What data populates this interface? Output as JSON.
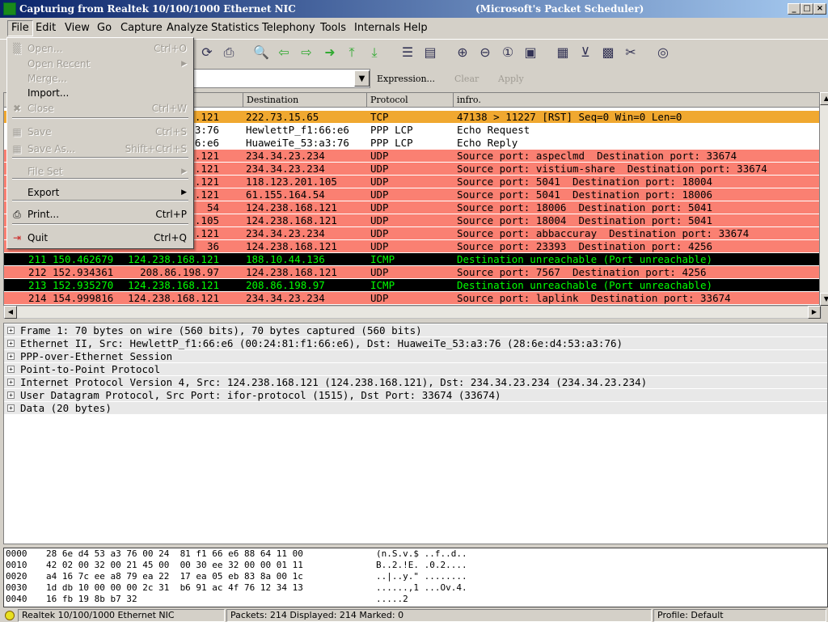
{
  "window": {
    "title": "Capturing from Realtek 10/100/1000 Ethernet NIC",
    "title_suffix": "(Microsoft's Packet Scheduler)",
    "minimize": "_",
    "maximize": "□",
    "close": "×"
  },
  "menubar": [
    "File",
    "Edit",
    "View",
    "Go",
    "Capture",
    "Analyze",
    "Statistics",
    "Telephony",
    "Tools",
    "Internals",
    "Help"
  ],
  "file_menu": [
    {
      "label": "Open...",
      "shortcut": "Ctrl+O",
      "icon": "folder-icon",
      "disabled": true
    },
    {
      "label": "Open Recent",
      "submenu": true,
      "disabled": true
    },
    {
      "label": "Merge...",
      "disabled": true
    },
    {
      "label": "Import...",
      "disabled": false
    },
    {
      "label": "Close",
      "shortcut": "Ctrl+W",
      "icon": "close-icon",
      "disabled": true
    },
    {
      "label": "Save",
      "shortcut": "Ctrl+S",
      "icon": "save-icon",
      "disabled": true
    },
    {
      "label": "Save As...",
      "shortcut": "Shift+Ctrl+S",
      "icon": "save-as-icon",
      "disabled": true
    },
    {
      "label": "File Set",
      "submenu": true,
      "disabled": true
    },
    {
      "label": "Export",
      "submenu": true,
      "disabled": false
    },
    {
      "label": "Print...",
      "shortcut": "Ctrl+P",
      "icon": "printer-icon",
      "disabled": false
    },
    {
      "label": "Quit",
      "shortcut": "Ctrl+Q",
      "icon": "quit-icon",
      "disabled": false
    }
  ],
  "toolbar": {
    "icons": [
      "reload-icon",
      "print-icon",
      "find-icon",
      "go-back-icon",
      "go-forward-icon",
      "go-to-packet-icon",
      "go-first-icon",
      "go-last-icon",
      "colorize-icon",
      "autoscroll-icon",
      "zoom-in-icon",
      "zoom-out-icon",
      "zoom-normal-icon",
      "resize-columns-icon",
      "capture-filters-icon",
      "display-filters-icon",
      "coloring-rules-icon",
      "preferences-icon",
      "help-icon"
    ]
  },
  "filter": {
    "value": "",
    "expression": "Expression...",
    "clear": "Clear",
    "apply": "Apply"
  },
  "packet_list": {
    "columns": [
      "Destination",
      "Protocol",
      "infro."
    ],
    "rows": [
      {
        "no": "",
        "time": "",
        "src": ".121",
        "dst": "222.73.15.65",
        "proto": "TCP",
        "info": "47138 > 11227 [RST] Seq=0 Win=0 Len=0",
        "bg": "#f0a830",
        "fg": "#000000"
      },
      {
        "no": "",
        "time": "",
        "src": ":a3:76",
        "dst": "HewlettP_f1:66:e6",
        "proto": "PPP LCP",
        "info": "Echo Request",
        "bg": "#ffffff",
        "fg": "#000000"
      },
      {
        "no": "",
        "time": "",
        "src": ":66:e6",
        "dst": "HuaweiTe_53:a3:76",
        "proto": "PPP LCP",
        "info": "Echo Reply",
        "bg": "#ffffff",
        "fg": "#000000"
      },
      {
        "no": "",
        "time": "",
        "src": ".121",
        "dst": "234.34.23.234",
        "proto": "UDP",
        "info": "Source port: aspeclmd  Destination port: 33674",
        "bg": "#fa8072",
        "fg": "#000000"
      },
      {
        "no": "",
        "time": "",
        "src": ".121",
        "dst": "234.34.23.234",
        "proto": "UDP",
        "info": "Source port: vistium-share  Destination port: 33674",
        "bg": "#fa8072",
        "fg": "#000000"
      },
      {
        "no": "",
        "time": "",
        "src": ".121",
        "dst": "118.123.201.105",
        "proto": "UDP",
        "info": "Source port: 5041  Destination port: 18004",
        "bg": "#fa8072",
        "fg": "#000000"
      },
      {
        "no": "",
        "time": "",
        "src": ".121",
        "dst": "61.155.164.54",
        "proto": "UDP",
        "info": "Source port: 5041  Destination port: 18006",
        "bg": "#fa8072",
        "fg": "#000000"
      },
      {
        "no": "",
        "time": "",
        "src": "54",
        "dst": "124.238.168.121",
        "proto": "UDP",
        "info": "Source port: 18006  Destination port: 5041",
        "bg": "#fa8072",
        "fg": "#000000"
      },
      {
        "no": "",
        "time": "",
        "src": ".105",
        "dst": "124.238.168.121",
        "proto": "UDP",
        "info": "Source port: 18004  Destination port: 5041",
        "bg": "#fa8072",
        "fg": "#000000"
      },
      {
        "no": "",
        "time": "",
        "src": ".121",
        "dst": "234.34.23.234",
        "proto": "UDP",
        "info": "Source port: abbaccuray  Destination port: 33674",
        "bg": "#fa8072",
        "fg": "#000000"
      },
      {
        "no": "",
        "time": "",
        "src": "36",
        "dst": "124.238.168.121",
        "proto": "UDP",
        "info": "Source port: 23393  Destination port: 4256",
        "bg": "#fa8072",
        "fg": "#000000"
      },
      {
        "no": "211",
        "time": "150.462679",
        "src": "124.238.168.121",
        "dst": "188.10.44.136",
        "proto": "ICMP",
        "info": "Destination unreachable (Port unreachable)",
        "bg": "#000000",
        "fg": "#00ff00"
      },
      {
        "no": "212",
        "time": "152.934361",
        "src": "208.86.198.97",
        "dst": "124.238.168.121",
        "proto": "UDP",
        "info": "Source port: 7567  Destination port: 4256",
        "bg": "#fa8072",
        "fg": "#000000"
      },
      {
        "no": "213",
        "time": "152.935270",
        "src": "124.238.168.121",
        "dst": "208.86.198.97",
        "proto": "ICMP",
        "info": "Destination unreachable (Port unreachable)",
        "bg": "#000000",
        "fg": "#00ff00"
      },
      {
        "no": "214",
        "time": "154.999816",
        "src": "124.238.168.121",
        "dst": "234.34.23.234",
        "proto": "UDP",
        "info": "Source port: laplink  Destination port: 33674",
        "bg": "#fa8072",
        "fg": "#000000"
      }
    ]
  },
  "details": [
    "Frame 1: 70 bytes on wire (560 bits), 70 bytes captured (560 bits)",
    "Ethernet II, Src: HewlettP_f1:66:e6 (00:24:81:f1:66:e6), Dst: HuaweiTe_53:a3:76 (28:6e:d4:53:a3:76)",
    "PPP-over-Ethernet Session",
    "Point-to-Point Protocol",
    "Internet Protocol Version 4, Src: 124.238.168.121 (124.238.168.121), Dst: 234.34.23.234 (234.34.23.234)",
    "User Datagram Protocol, Src Port: ifor-protocol (1515), Dst Port: 33674 (33674)",
    "Data (20 bytes)"
  ],
  "hex": [
    {
      "off": "0000",
      "bytes": "28 6e d4 53 a3 76 00 24  81 f1 66 e6 88 64 11 00",
      "ascii": "(n.S.v.$ ..f..d.."
    },
    {
      "off": "0010",
      "bytes": "42 02 00 32 00 21 45 00  00 30 ee 32 00 00 01 11",
      "ascii": "B..2.!E. .0.2...."
    },
    {
      "off": "0020",
      "bytes": "a4 16 7c ee a8 79 ea 22  17 ea 05 eb 83 8a 00 1c",
      "ascii": "..|..y.\" ........"
    },
    {
      "off": "0030",
      "bytes": "1d db 10 00 00 00 2c 31  b6 91 ac 4f 76 12 34 13",
      "ascii": "......,1 ...Ov.4."
    },
    {
      "off": "0040",
      "bytes": "16 fb 19 8b b7 32",
      "ascii": ".....2"
    }
  ],
  "status": {
    "interface": "Realtek 10/100/1000 Ethernet NIC",
    "packets": "Packets: 214 Displayed: 214 Marked: 0",
    "profile": "Profile: Default"
  }
}
